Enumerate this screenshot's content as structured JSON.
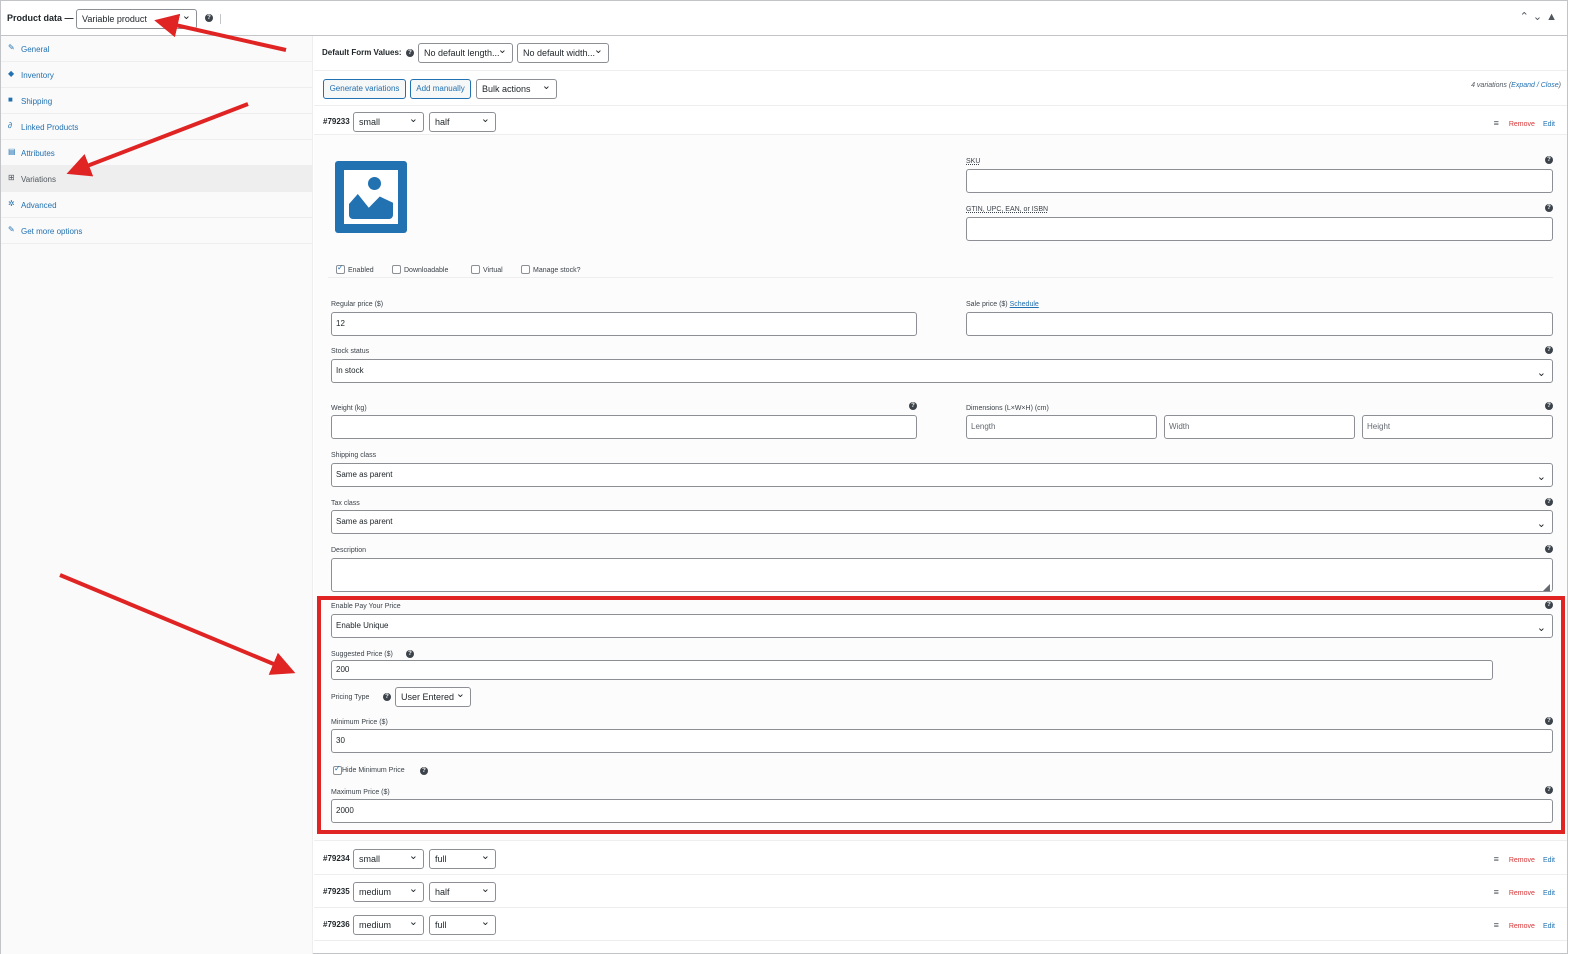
{
  "header": {
    "title": "Product data —",
    "product_type": "Variable product"
  },
  "sidebar": {
    "items": [
      {
        "label": "General",
        "icon": "wrench-icon",
        "glyph": "🔧"
      },
      {
        "label": "Inventory",
        "icon": "tag-icon",
        "glyph": "◆"
      },
      {
        "label": "Shipping",
        "icon": "truck-icon",
        "glyph": "■"
      },
      {
        "label": "Linked Products",
        "icon": "link-icon",
        "glyph": "∂"
      },
      {
        "label": "Attributes",
        "icon": "list-icon",
        "glyph": "▤"
      },
      {
        "label": "Variations",
        "icon": "grid-icon",
        "glyph": "⊞"
      },
      {
        "label": "Advanced",
        "icon": "gear-icon",
        "glyph": "✲"
      },
      {
        "label": "Get more options",
        "icon": "plugin-icon",
        "glyph": "✎"
      }
    ],
    "active": "Variations"
  },
  "toolbar": {
    "default_form_label": "Default Form Values:",
    "length_select": "No default length...",
    "width_select": "No default width...",
    "generate_label": "Generate variations",
    "add_manually_label": "Add manually",
    "bulk_actions": "Bulk actions",
    "count_text": "4 variations (",
    "expand_close": "Expand / Close",
    "count_close": ")"
  },
  "variations": [
    {
      "id": "#79233",
      "size": "small",
      "length": "half"
    },
    {
      "id": "#79234",
      "size": "small",
      "length": "full"
    },
    {
      "id": "#79235",
      "size": "medium",
      "length": "half"
    },
    {
      "id": "#79236",
      "size": "medium",
      "length": "full"
    }
  ],
  "row_actions": {
    "remove": "Remove",
    "edit": "Edit"
  },
  "panel": {
    "sku_label": "SKU",
    "gtin_label": "GTIN, UPC, EAN, or ISBN",
    "enabled": "Enabled",
    "downloadable": "Downloadable",
    "virtual": "Virtual",
    "manage_stock": "Manage stock?",
    "regular_price_label": "Regular price ($)",
    "regular_price": "12",
    "sale_price_label": "Sale price ($)",
    "schedule": "Schedule",
    "stock_status_label": "Stock status",
    "stock_status": "In stock",
    "weight_label": "Weight (kg)",
    "dimensions_label": "Dimensions (L×W×H) (cm)",
    "length_ph": "Length",
    "width_ph": "Width",
    "height_ph": "Height",
    "shipping_class_label": "Shipping class",
    "shipping_class": "Same as parent",
    "tax_class_label": "Tax class",
    "tax_class": "Same as parent",
    "description_label": "Description",
    "pyp_label": "Enable Pay Your Price",
    "pyp_value": "Enable Unique",
    "suggested_label": "Suggested Price ($)",
    "suggested_value": "200",
    "pricing_type_label": "Pricing Type",
    "pricing_type": "User Entered",
    "min_label": "Minimum Price ($)",
    "min_value": "30",
    "hide_min_label": "Hide Minimum Price",
    "max_label": "Maximum Price ($)",
    "max_value": "2000"
  },
  "colors": {
    "accent": "#2271b1",
    "annotation": "#e02424",
    "remove": "#d63638"
  }
}
